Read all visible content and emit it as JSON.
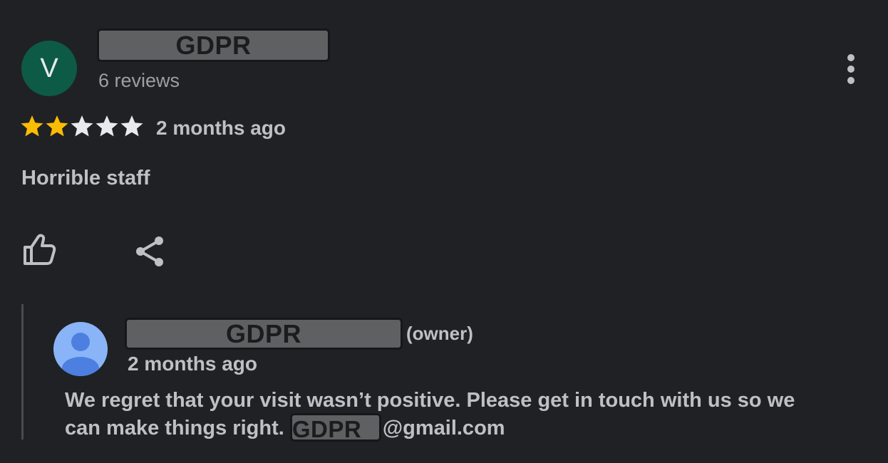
{
  "review": {
    "avatar_letter": "V",
    "reviewer_name": "GDPR",
    "review_count": "6 reviews",
    "rating": 2,
    "rating_max": 5,
    "time": "2 months ago",
    "text": "Horrible staff",
    "colors": {
      "avatar_bg": "#0d5a47",
      "star_filled": "#fbbc04",
      "star_empty": "#e8eaed"
    }
  },
  "actions": {
    "like_icon": "thumbs-up-icon",
    "share_icon": "share-icon",
    "more_icon": "more-vertical-icon"
  },
  "reply": {
    "owner_name": "GDPR",
    "owner_tag": "(owner)",
    "time": "2 months ago",
    "text": "We regret that your visit wasn’t positive. Please get in touch with us so we can make things right.",
    "email_redacted": "GDPR",
    "email_domain": "@gmail.com",
    "avatar_icon": "person-icon"
  }
}
